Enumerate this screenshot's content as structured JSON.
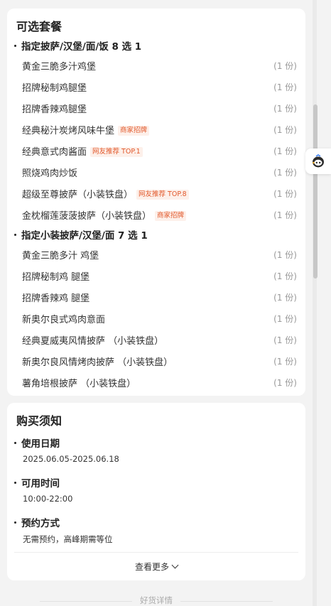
{
  "package": {
    "title": "可选套餐",
    "groups": [
      {
        "title": "指定披萨/汉堡/面/饭 8 选 1",
        "items": [
          {
            "name": "黄金三脆多汁鸡堡",
            "qty": "(1 份)",
            "tag": ""
          },
          {
            "name": "招牌秘制鸡腿堡",
            "qty": "(1 份)",
            "tag": ""
          },
          {
            "name": "招牌香辣鸡腿堡",
            "qty": "(1 份)",
            "tag": ""
          },
          {
            "name": "经典秘汁炭烤风味牛堡",
            "qty": "(1 份)",
            "tag": "商家招牌"
          },
          {
            "name": "经典意式肉酱面",
            "qty": "(1 份)",
            "tag": "网友推荐 TOP.1"
          },
          {
            "name": "照烧鸡肉炒饭",
            "qty": "(1 份)",
            "tag": ""
          },
          {
            "name": "超级至尊披萨（小装铁盘）",
            "qty": "(1 份)",
            "tag": "网友推荐 TOP.8"
          },
          {
            "name": "金枕榴莲菠菠披萨（小装铁盘）",
            "qty": "(1 份)",
            "tag": "商家招牌"
          }
        ]
      },
      {
        "title": "指定小装披萨/汉堡/面 7 选 1",
        "items": [
          {
            "name": "黄金三脆多汁 鸡堡",
            "qty": "(1 份)",
            "tag": ""
          },
          {
            "name": "招牌秘制鸡 腿堡",
            "qty": "(1 份)",
            "tag": ""
          },
          {
            "name": "招牌香辣鸡 腿堡",
            "qty": "(1 份)",
            "tag": ""
          },
          {
            "name": "新奥尔良式鸡肉意面",
            "qty": "(1 份)",
            "tag": ""
          },
          {
            "name": "经典夏威夷风情披萨 （小装铁盘）",
            "qty": "(1 份)",
            "tag": ""
          },
          {
            "name": "新奥尔良风情烤肉披萨 （小装铁盘）",
            "qty": "(1 份)",
            "tag": ""
          },
          {
            "name": "薯角培根披萨 （小装铁盘）",
            "qty": "(1 份)",
            "tag": ""
          }
        ]
      }
    ]
  },
  "notice": {
    "title": "购买须知",
    "sections": [
      {
        "label": "使用日期",
        "value": "2025.06.05-2025.06.18"
      },
      {
        "label": "可用时间",
        "value": "10:00-22:00"
      },
      {
        "label": "预约方式",
        "value": "无需预约，高峰期需等位"
      }
    ],
    "see_more": "查看更多"
  },
  "footer": {
    "label": "好货详情"
  },
  "icons": {
    "float_button": "assistant-robot-icon",
    "see_more": "chevron-down-icon"
  },
  "colors": {
    "tag_text": "#e2582b",
    "tag_bg": "#fdf0ea",
    "page_bg": "#f3f3f3"
  }
}
